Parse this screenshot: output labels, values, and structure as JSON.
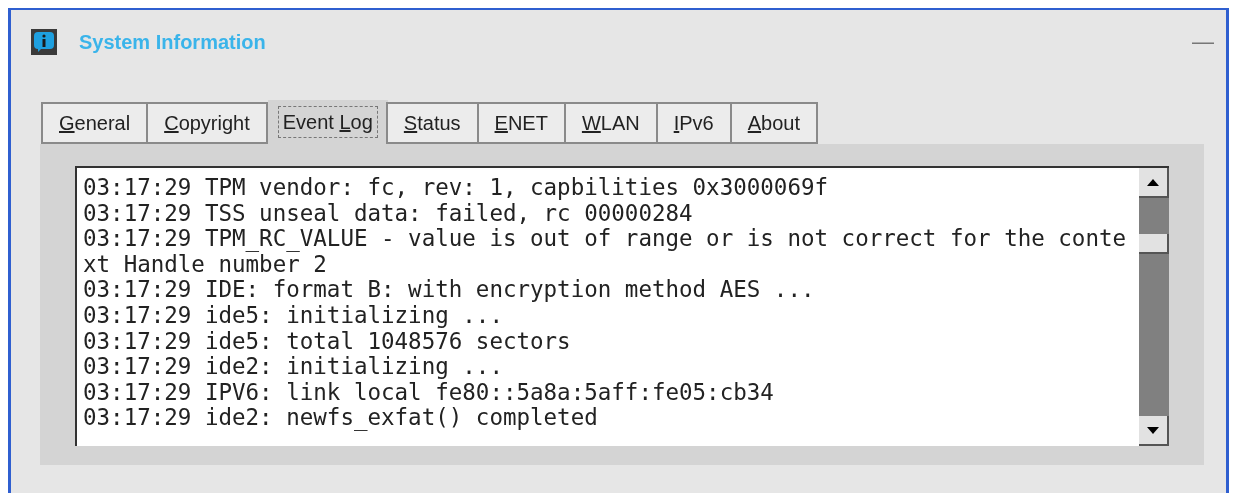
{
  "window": {
    "title": "System Information",
    "minimize_glyph": "—"
  },
  "tabs": [
    {
      "mnemonic": "G",
      "after": "eneral",
      "selected": false
    },
    {
      "mnemonic": "C",
      "after": "opyright",
      "selected": false
    },
    {
      "before": "Event ",
      "mnemonic": "L",
      "after": "og",
      "selected": true
    },
    {
      "mnemonic": "S",
      "after": "tatus",
      "selected": false
    },
    {
      "mnemonic": "E",
      "after": "NET",
      "selected": false
    },
    {
      "mnemonic": "W",
      "after": "LAN",
      "selected": false
    },
    {
      "mnemonic": "I",
      "after": "Pv6",
      "selected": false
    },
    {
      "mnemonic": "A",
      "after": "bout",
      "selected": false
    }
  ],
  "event_log": {
    "lines": [
      "03:17:29 TPM vendor: fc, rev: 1, capbilities 0x3000069f",
      "03:17:29 TSS unseal data: failed, rc 00000284",
      "03:17:29 TPM_RC_VALUE - value is out of range or is not correct for the conte",
      "xt Handle number 2",
      "03:17:29 IDE: format B: with encryption method AES ...",
      "03:17:29 ide5: initializing ...",
      "03:17:29 ide5: total 1048576 sectors",
      "03:17:29 ide2: initializing ...",
      "03:17:29 IPV6: link local fe80::5a8a:5aff:fe05:cb34",
      "03:17:29 ide2: newfs_exfat() completed"
    ]
  }
}
